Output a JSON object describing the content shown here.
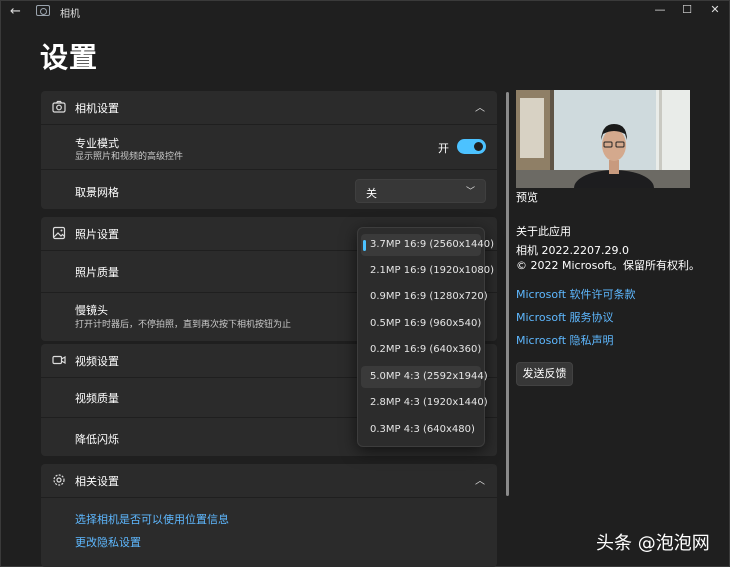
{
  "titlebar": {
    "back_icon": "back-arrow-icon",
    "title": "相机",
    "minimize": "—",
    "maximize": "☐",
    "close": "✕"
  },
  "page_title": "设置",
  "camera_settings": {
    "title": "相机设置",
    "pro_mode": {
      "label": "专业模式",
      "description": "显示照片和视频的高级控件",
      "toggle_text": "开",
      "state": "on"
    },
    "framing_grid": {
      "label": "取景网格",
      "value": "关"
    }
  },
  "photo_settings": {
    "title": "照片设置",
    "quality_label": "照片质量",
    "time_lapse": {
      "label": "慢镜头",
      "description": "打开计时器后，不停拍照，直到再次按下相机按钮为止"
    }
  },
  "photo_quality_options": [
    "3.7MP 16:9 (2560x1440)",
    "2.1MP 16:9 (1920x1080)",
    "0.9MP 16:9 (1280x720)",
    "0.5MP 16:9 (960x540)",
    "0.2MP 16:9 (640x360)",
    "5.0MP 4:3 (2592x1944)",
    "2.8MP 4:3 (1920x1440)",
    "0.3MP 4:3 (640x480)"
  ],
  "photo_quality_selected_index": 0,
  "video_settings": {
    "title": "视频设置",
    "quality_label": "视频质量",
    "flicker_label": "降低闪烁"
  },
  "related_settings": {
    "title": "相关设置",
    "links": [
      "选择相机是否可以使用位置信息",
      "更改隐私设置"
    ]
  },
  "right_panel": {
    "preview_label": "预览",
    "about_title": "关于此应用",
    "version": "相机   2022.2207.29.0",
    "copyright": "© 2022 Microsoft。保留所有权利。",
    "links": [
      "Microsoft 软件许可条款",
      "Microsoft 服务协议",
      "Microsoft 隐私声明"
    ],
    "feedback_button": "发送反馈"
  },
  "watermark": "头条 @泡泡网",
  "colors": {
    "accent": "#4cc2ff",
    "link": "#5eb8ff",
    "background": "#1f1f1f",
    "card": "#2b2b2b"
  }
}
